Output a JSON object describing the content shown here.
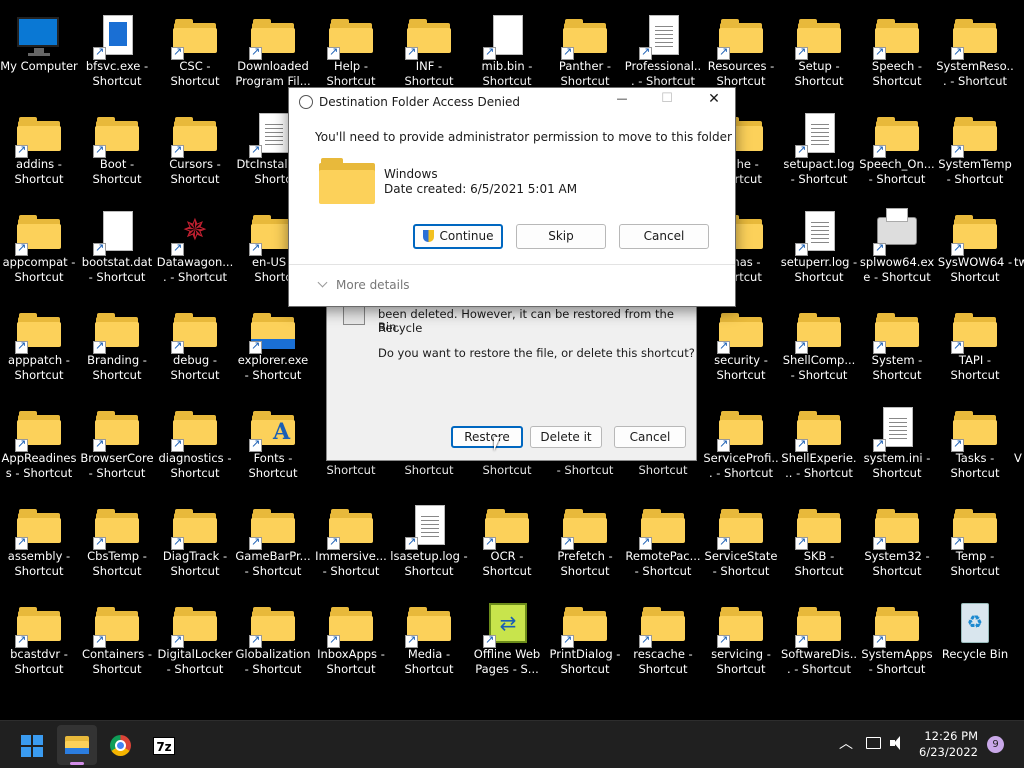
{
  "desktop": {
    "icons": [
      {
        "label": "My Computer",
        "icon": "computer-icon",
        "col": 0,
        "row": 0,
        "kind": "monitor",
        "shortcut": false
      },
      {
        "label": "bfsvc.exe - Shortcut",
        "icon": "exe-icon",
        "col": 1,
        "row": 0,
        "kind": "exe",
        "shortcut": true
      },
      {
        "label": "CSC - Shortcut",
        "icon": "folder-icon",
        "col": 2,
        "row": 0,
        "kind": "folder",
        "shortcut": true
      },
      {
        "label": "Downloaded Program Fil...",
        "icon": "folder-icon",
        "col": 3,
        "row": 0,
        "kind": "folder",
        "shortcut": true
      },
      {
        "label": "Help - Shortcut",
        "icon": "folder-icon",
        "col": 4,
        "row": 0,
        "kind": "folder",
        "shortcut": true
      },
      {
        "label": "INF - Shortcut",
        "icon": "folder-icon",
        "col": 5,
        "row": 0,
        "kind": "folder",
        "shortcut": true
      },
      {
        "label": "mib.bin - Shortcut",
        "icon": "file-icon",
        "col": 6,
        "row": 0,
        "kind": "blank",
        "shortcut": true
      },
      {
        "label": "Panther - Shortcut",
        "icon": "folder-icon",
        "col": 7,
        "row": 0,
        "kind": "folder",
        "shortcut": true
      },
      {
        "label": "Professional... - Shortcut",
        "icon": "document-icon",
        "col": 8,
        "row": 0,
        "kind": "doc",
        "shortcut": true
      },
      {
        "label": "Resources - Shortcut",
        "icon": "folder-icon",
        "col": 9,
        "row": 0,
        "kind": "folder",
        "shortcut": true
      },
      {
        "label": "Setup - Shortcut",
        "icon": "folder-icon",
        "col": 10,
        "row": 0,
        "kind": "folder",
        "shortcut": true
      },
      {
        "label": "Speech - Shortcut",
        "icon": "folder-icon",
        "col": 11,
        "row": 0,
        "kind": "folder",
        "shortcut": true
      },
      {
        "label": "SystemReso... - Shortcut",
        "icon": "folder-icon",
        "col": 12,
        "row": 0,
        "kind": "folder",
        "shortcut": true
      },
      {
        "label": "addins - Shortcut",
        "icon": "folder-icon",
        "col": 0,
        "row": 1,
        "kind": "folder",
        "shortcut": true
      },
      {
        "label": "Boot - Shortcut",
        "icon": "folder-icon",
        "col": 1,
        "row": 1,
        "kind": "folder",
        "shortcut": true
      },
      {
        "label": "Cursors - Shortcut",
        "icon": "folder-icon",
        "col": 2,
        "row": 1,
        "kind": "folder",
        "shortcut": true
      },
      {
        "label": "DtcInstall... - Shortc",
        "icon": "document-icon",
        "col": 3,
        "row": 1,
        "kind": "doc",
        "shortcut": true
      },
      {
        "label": "ache - hortcut",
        "icon": "folder-icon",
        "col": 9,
        "row": 1,
        "kind": "folder",
        "shortcut": true
      },
      {
        "label": "setupact.log - Shortcut",
        "icon": "document-icon",
        "col": 10,
        "row": 1,
        "kind": "doc",
        "shortcut": true
      },
      {
        "label": "Speech_On... - Shortcut",
        "icon": "folder-icon",
        "col": 11,
        "row": 1,
        "kind": "folder",
        "shortcut": true
      },
      {
        "label": "SystemTemp - Shortcut",
        "icon": "folder-icon",
        "col": 12,
        "row": 1,
        "kind": "folder",
        "shortcut": true
      },
      {
        "label": "appcompat - Shortcut",
        "icon": "folder-icon",
        "col": 0,
        "row": 2,
        "kind": "folder",
        "shortcut": true
      },
      {
        "label": "bootstat.dat - Shortcut",
        "icon": "file-icon",
        "col": 1,
        "row": 2,
        "kind": "blank",
        "shortcut": true
      },
      {
        "label": "Datawagon.... - Shortcut",
        "icon": "datawagon-icon",
        "col": 2,
        "row": 2,
        "kind": "star",
        "shortcut": true
      },
      {
        "label": "en-US - Shortc",
        "icon": "folder-icon",
        "col": 3,
        "row": 2,
        "kind": "folder",
        "shortcut": true
      },
      {
        "label": "emas - hortcut",
        "icon": "folder-icon",
        "col": 9,
        "row": 2,
        "kind": "folder",
        "shortcut": true
      },
      {
        "label": "setuperr.log - Shortcut",
        "icon": "document-icon",
        "col": 10,
        "row": 2,
        "kind": "doc",
        "shortcut": true
      },
      {
        "label": "splwow64.exe - Shortcut",
        "icon": "printer-icon",
        "col": 11,
        "row": 2,
        "kind": "printer",
        "shortcut": true
      },
      {
        "label": "SysWOW64 - Shortcut",
        "icon": "folder-icon",
        "col": 12,
        "row": 2,
        "kind": "folder",
        "shortcut": true
      },
      {
        "label": "apppatch - Shortcut",
        "icon": "folder-icon",
        "col": 0,
        "row": 3,
        "kind": "folder",
        "shortcut": true
      },
      {
        "label": "Branding - Shortcut",
        "icon": "folder-icon",
        "col": 1,
        "row": 3,
        "kind": "folder",
        "shortcut": true
      },
      {
        "label": "debug - Shortcut",
        "icon": "folder-icon",
        "col": 2,
        "row": 3,
        "kind": "folder",
        "shortcut": true
      },
      {
        "label": "explorer.exe - Shortcut",
        "icon": "explorer-icon",
        "col": 3,
        "row": 3,
        "kind": "explorer",
        "shortcut": true
      },
      {
        "label": "security - Shortcut",
        "icon": "folder-icon",
        "col": 9,
        "row": 3,
        "kind": "folder",
        "shortcut": true
      },
      {
        "label": "ShellComp... - Shortcut",
        "icon": "folder-icon",
        "col": 10,
        "row": 3,
        "kind": "folder",
        "shortcut": true
      },
      {
        "label": "System - Shortcut",
        "icon": "folder-icon",
        "col": 11,
        "row": 3,
        "kind": "folder",
        "shortcut": true
      },
      {
        "label": "TAPI - Shortcut",
        "icon": "folder-icon",
        "col": 12,
        "row": 3,
        "kind": "folder",
        "shortcut": true
      },
      {
        "label": "AppReadiness - Shortcut",
        "icon": "folder-icon",
        "col": 0,
        "row": 4,
        "kind": "folder",
        "shortcut": true
      },
      {
        "label": "BrowserCore - Shortcut",
        "icon": "folder-icon",
        "col": 1,
        "row": 4,
        "kind": "folder",
        "shortcut": true
      },
      {
        "label": "diagnostics - Shortcut",
        "icon": "folder-icon",
        "col": 2,
        "row": 4,
        "kind": "folder",
        "shortcut": true
      },
      {
        "label": "Fonts - Shortcut",
        "icon": "fonts-folder-icon",
        "col": 3,
        "row": 4,
        "kind": "fonts",
        "shortcut": true
      },
      {
        "label": "Shortcut",
        "icon": "folder-icon",
        "col": 4,
        "row": 4,
        "kind": "labelonly",
        "shortcut": false
      },
      {
        "label": "Shortcut",
        "icon": "folder-icon",
        "col": 5,
        "row": 4,
        "kind": "labelonly",
        "shortcut": false
      },
      {
        "label": "Shortcut",
        "icon": "folder-icon",
        "col": 6,
        "row": 4,
        "kind": "labelonly",
        "shortcut": false
      },
      {
        "label": "- Shortcut",
        "icon": "folder-icon",
        "col": 7,
        "row": 4,
        "kind": "labelonly",
        "shortcut": false
      },
      {
        "label": "Shortcut",
        "icon": "folder-icon",
        "col": 8,
        "row": 4,
        "kind": "labelonly",
        "shortcut": false
      },
      {
        "label": "ServiceProfi... - Shortcut",
        "icon": "folder-icon",
        "col": 9,
        "row": 4,
        "kind": "folder",
        "shortcut": true
      },
      {
        "label": "ShellExperie... - Shortcut",
        "icon": "folder-icon",
        "col": 10,
        "row": 4,
        "kind": "folder",
        "shortcut": true
      },
      {
        "label": "system.ini - Shortcut",
        "icon": "settings-file-icon",
        "col": 11,
        "row": 4,
        "kind": "doc",
        "shortcut": true
      },
      {
        "label": "Tasks - Shortcut",
        "icon": "folder-icon",
        "col": 12,
        "row": 4,
        "kind": "folder",
        "shortcut": true
      },
      {
        "label": "assembly - Shortcut",
        "icon": "folder-icon",
        "col": 0,
        "row": 5,
        "kind": "folder",
        "shortcut": true
      },
      {
        "label": "CbsTemp - Shortcut",
        "icon": "folder-icon",
        "col": 1,
        "row": 5,
        "kind": "folder",
        "shortcut": true
      },
      {
        "label": "DiagTrack - Shortcut",
        "icon": "folder-icon",
        "col": 2,
        "row": 5,
        "kind": "folder",
        "shortcut": true
      },
      {
        "label": "GameBarPr... - Shortcut",
        "icon": "folder-icon",
        "col": 3,
        "row": 5,
        "kind": "folder",
        "shortcut": true
      },
      {
        "label": "Immersive... - Shortcut",
        "icon": "folder-icon",
        "col": 4,
        "row": 5,
        "kind": "folder",
        "shortcut": true
      },
      {
        "label": "lsasetup.log - Shortcut",
        "icon": "document-icon",
        "col": 5,
        "row": 5,
        "kind": "doc",
        "shortcut": true
      },
      {
        "label": "OCR - Shortcut",
        "icon": "folder-icon",
        "col": 6,
        "row": 5,
        "kind": "folder",
        "shortcut": true
      },
      {
        "label": "Prefetch - Shortcut",
        "icon": "folder-icon",
        "col": 7,
        "row": 5,
        "kind": "folder",
        "shortcut": true
      },
      {
        "label": "RemotePac... - Shortcut",
        "icon": "folder-icon",
        "col": 8,
        "row": 5,
        "kind": "folder",
        "shortcut": true
      },
      {
        "label": "ServiceState - Shortcut",
        "icon": "folder-icon",
        "col": 9,
        "row": 5,
        "kind": "folder",
        "shortcut": true
      },
      {
        "label": "SKB - Shortcut",
        "icon": "folder-icon",
        "col": 10,
        "row": 5,
        "kind": "folder",
        "shortcut": true
      },
      {
        "label": "System32 - Shortcut",
        "icon": "folder-icon",
        "col": 11,
        "row": 5,
        "kind": "folder",
        "shortcut": true
      },
      {
        "label": "Temp - Shortcut",
        "icon": "folder-icon",
        "col": 12,
        "row": 5,
        "kind": "folder",
        "shortcut": true
      },
      {
        "label": "bcastdvr - Shortcut",
        "icon": "folder-icon",
        "col": 0,
        "row": 6,
        "kind": "folder",
        "shortcut": true
      },
      {
        "label": "Containers - Shortcut",
        "icon": "folder-icon",
        "col": 1,
        "row": 6,
        "kind": "folder",
        "shortcut": true
      },
      {
        "label": "DigitalLocker - Shortcut",
        "icon": "folder-icon",
        "col": 2,
        "row": 6,
        "kind": "folder",
        "shortcut": true
      },
      {
        "label": "Globalization - Shortcut",
        "icon": "folder-icon",
        "col": 3,
        "row": 6,
        "kind": "folder",
        "shortcut": true
      },
      {
        "label": "InboxApps - Shortcut",
        "icon": "folder-icon",
        "col": 4,
        "row": 6,
        "kind": "folder",
        "shortcut": true
      },
      {
        "label": "Media - Shortcut",
        "icon": "folder-icon",
        "col": 5,
        "row": 6,
        "kind": "folder",
        "shortcut": true
      },
      {
        "label": "Offline Web Pages - S...",
        "icon": "webpage-icon",
        "col": 6,
        "row": 6,
        "kind": "webpage",
        "shortcut": true
      },
      {
        "label": "PrintDialog - Shortcut",
        "icon": "folder-icon",
        "col": 7,
        "row": 6,
        "kind": "folder",
        "shortcut": true
      },
      {
        "label": "rescache - Shortcut",
        "icon": "folder-icon",
        "col": 8,
        "row": 6,
        "kind": "folder",
        "shortcut": true
      },
      {
        "label": "servicing - Shortcut",
        "icon": "folder-icon",
        "col": 9,
        "row": 6,
        "kind": "folder",
        "shortcut": true
      },
      {
        "label": "SoftwareDis... - Shortcut",
        "icon": "folder-icon",
        "col": 10,
        "row": 6,
        "kind": "folder",
        "shortcut": true
      },
      {
        "label": "SystemApps - Shortcut",
        "icon": "folder-icon",
        "col": 11,
        "row": 6,
        "kind": "folder",
        "shortcut": true
      },
      {
        "label": "Recycle Bin",
        "icon": "recycle-bin-icon",
        "col": 12,
        "row": 6,
        "kind": "recycle",
        "shortcut": false
      }
    ],
    "edge_fragments": [
      "tw",
      "V"
    ]
  },
  "back_dialog": {
    "message_line1": "been deleted. However, it can be restored from the Recycle",
    "message_line2": "Bin.",
    "question": "Do you want to restore the file, or delete this shortcut?",
    "restore_label": "Restore",
    "delete_label": "Delete it",
    "cancel_label": "Cancel"
  },
  "front_dialog": {
    "title": "Destination Folder Access Denied",
    "message": "You'll need to provide administrator permission to move to this folder",
    "folder_name": "Windows",
    "date_created": "Date created: 6/5/2021 5:01 AM",
    "continue_label": "Continue",
    "skip_label": "Skip",
    "cancel_label": "Cancel",
    "more_details": "More details",
    "minimize_glyph": "—",
    "maximize_glyph": "☐",
    "close_glyph": "✕"
  },
  "taskbar": {
    "clock_time": "12:26 PM",
    "clock_date": "6/23/2022",
    "notification_count": "9",
    "chevron": "︿",
    "sevenzip_label": "7z"
  },
  "colors": {
    "accent": "#0067c0",
    "folder": "#fcd15a",
    "taskbar": "#202020",
    "notification_badge": "#c9a8e8"
  }
}
